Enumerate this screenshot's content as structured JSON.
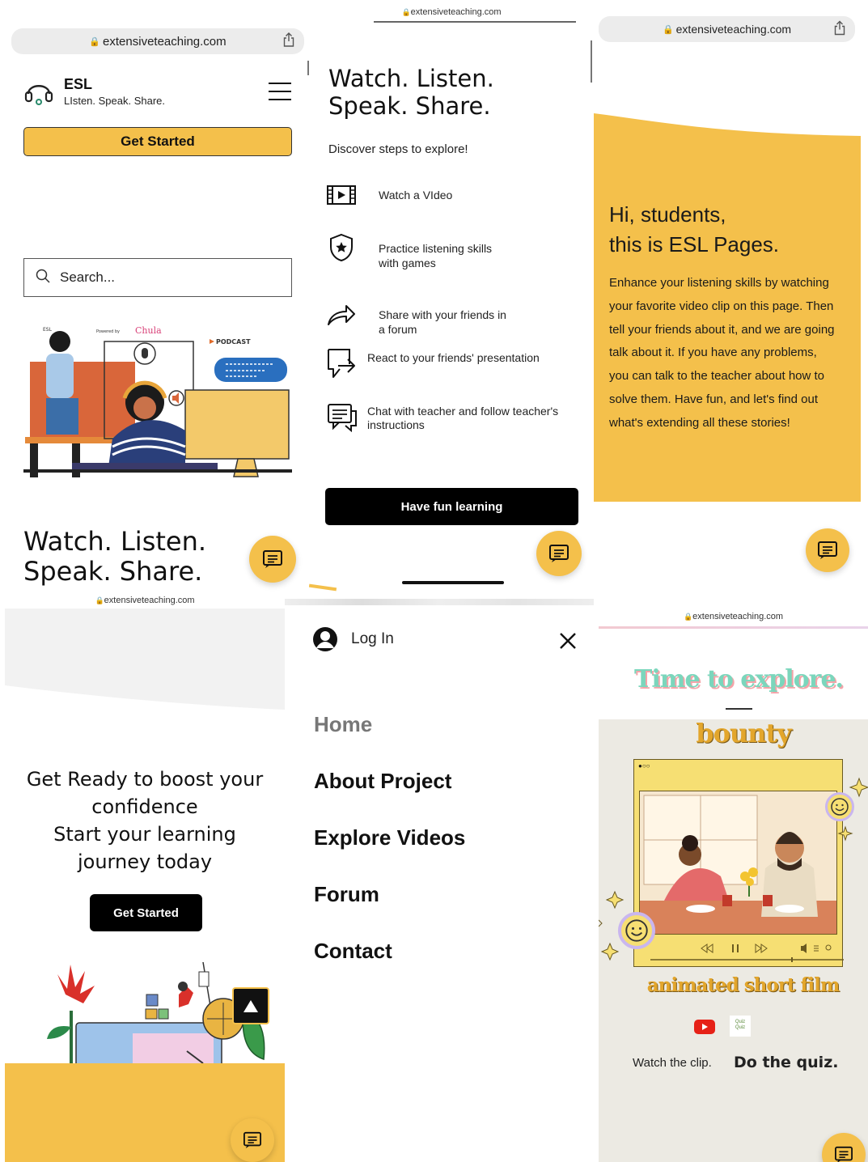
{
  "panel1": {
    "url": "extensiveteaching.com",
    "brand_name": "ESL",
    "brand_tagline": "LIsten. Speak. Share.",
    "cta_label": "Get Started",
    "search_placeholder": "Search...",
    "illus_esl": "ESL",
    "illus_powered": "Powered by",
    "illus_chula": "Chula",
    "illus_podcast": "PODCAST",
    "headline_1": "Watch. Listen.",
    "headline_2": "Speak. Share."
  },
  "panel2": {
    "url": "extensiveteaching.com",
    "headline_1": "Watch. Listen.",
    "headline_2": "Speak. Share.",
    "intro": "Discover steps to explore!",
    "steps": [
      {
        "icon": "video-icon",
        "text_1": "Watch a VIdeo",
        "text_2": ""
      },
      {
        "icon": "shield-star-icon",
        "text_1": "Practice listening skills",
        "text_2": "with games"
      },
      {
        "icon": "share-arrow-icon",
        "text_1": "Share with your friends in",
        "text_2": "a forum"
      },
      {
        "icon": "comment-reply-icon",
        "text_1": "React to your friends' presentation",
        "text_2": ""
      },
      {
        "icon": "chat-icon",
        "text_1": "Chat with teacher and follow teacher's",
        "text_2": "instructions"
      }
    ],
    "cta_label": "Have fun learning"
  },
  "panel3": {
    "url": "extensiveteaching.com",
    "greeting_1": "Hi, students,",
    "greeting_2": "this is ESL Pages.",
    "body_lines": [
      "Enhance your listening skills by watching",
      "your favorite video clip on this page. Then",
      "tell your friends about it, and we are going",
      "talk about it. If you have any problems,",
      "you can talk to the teacher about how to",
      "solve them. Have fun, and let's find out",
      "what's extending all these stories!"
    ]
  },
  "panel4": {
    "url": "extensiveteaching.com",
    "line_1": "Get Ready to boost your",
    "line_2": "confidence",
    "line_3": "Start your learning",
    "line_4": "journey today",
    "cta_label": "Get Started"
  },
  "panel5": {
    "login_label": "Log In",
    "menu": [
      "Home",
      "About Project",
      "Explore Videos",
      "Forum",
      "Contact"
    ]
  },
  "panel6": {
    "url": "extensiveteaching.com",
    "title": "Time to explore.",
    "film_title": "bounty",
    "film_subtitle": "animated short film",
    "quiz_logo": "Quiz Quiz",
    "watch_label": "Watch the clip.",
    "quiz_label": "Do the quiz."
  },
  "colors": {
    "brand_yellow": "#f4c04b",
    "black": "#000000",
    "teal_title": "#6fd3b8",
    "pink_title_shadow": "#f4a3a8",
    "film_gold": "#d9a12a"
  }
}
